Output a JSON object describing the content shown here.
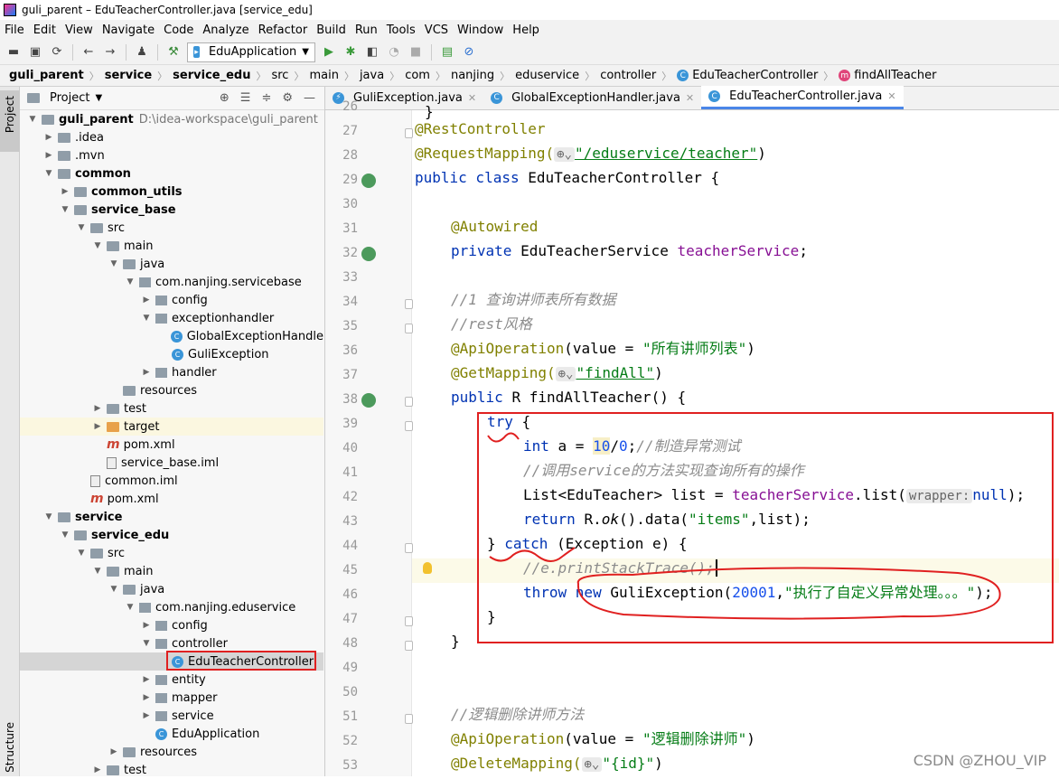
{
  "window": {
    "title": "guli_parent – EduTeacherController.java [service_edu]"
  },
  "menu": [
    "File",
    "Edit",
    "View",
    "Navigate",
    "Code",
    "Analyze",
    "Refactor",
    "Build",
    "Run",
    "Tools",
    "VCS",
    "Window",
    "Help"
  ],
  "toolbar": {
    "run_config": "EduApplication"
  },
  "breadcrumb": [
    "guli_parent",
    "service",
    "service_edu",
    "src",
    "main",
    "java",
    "com",
    "nanjing",
    "eduservice",
    "controller",
    "EduTeacherController",
    "findAllTeacher"
  ],
  "sidebar": {
    "project_tab": "Project",
    "bottom_tab": "Structure"
  },
  "project_panel": {
    "title": "Project",
    "root_path": "D:\\idea-workspace\\guli_parent"
  },
  "tree": [
    {
      "label": "guli_parent",
      "depth": 0,
      "icon": "folder",
      "arrow": "down",
      "bold": true
    },
    {
      "label": ".idea",
      "depth": 1,
      "icon": "folder",
      "arrow": "right"
    },
    {
      "label": ".mvn",
      "depth": 1,
      "icon": "folder",
      "arrow": "right"
    },
    {
      "label": "common",
      "depth": 1,
      "icon": "folder",
      "arrow": "down",
      "bold": true
    },
    {
      "label": "common_utils",
      "depth": 2,
      "icon": "folder",
      "arrow": "right",
      "bold": true
    },
    {
      "label": "service_base",
      "depth": 2,
      "icon": "folder",
      "arrow": "down",
      "bold": true
    },
    {
      "label": "src",
      "depth": 3,
      "icon": "folder",
      "arrow": "down"
    },
    {
      "label": "main",
      "depth": 4,
      "icon": "folder",
      "arrow": "down"
    },
    {
      "label": "java",
      "depth": 5,
      "icon": "folder",
      "arrow": "down"
    },
    {
      "label": "com.nanjing.servicebase",
      "depth": 6,
      "icon": "pkg",
      "arrow": "down"
    },
    {
      "label": "config",
      "depth": 7,
      "icon": "pkg",
      "arrow": "right"
    },
    {
      "label": "exceptionhandler",
      "depth": 7,
      "icon": "pkg",
      "arrow": "down"
    },
    {
      "label": "GlobalExceptionHandle",
      "depth": 8,
      "icon": "class",
      "arrow": ""
    },
    {
      "label": "GuliException",
      "depth": 8,
      "icon": "class",
      "arrow": ""
    },
    {
      "label": "handler",
      "depth": 7,
      "icon": "pkg",
      "arrow": "right"
    },
    {
      "label": "resources",
      "depth": 5,
      "icon": "folder",
      "arrow": ""
    },
    {
      "label": "test",
      "depth": 4,
      "icon": "folder",
      "arrow": "right"
    },
    {
      "label": "target",
      "depth": 4,
      "icon": "folder-orange",
      "arrow": "right"
    },
    {
      "label": "pom.xml",
      "depth": 4,
      "icon": "mvn",
      "arrow": ""
    },
    {
      "label": "service_base.iml",
      "depth": 4,
      "icon": "file",
      "arrow": ""
    },
    {
      "label": "common.iml",
      "depth": 3,
      "icon": "file",
      "arrow": ""
    },
    {
      "label": "pom.xml",
      "depth": 3,
      "icon": "mvn",
      "arrow": ""
    },
    {
      "label": "service",
      "depth": 1,
      "icon": "folder",
      "arrow": "down",
      "bold": true
    },
    {
      "label": "service_edu",
      "depth": 2,
      "icon": "folder",
      "arrow": "down",
      "bold": true
    },
    {
      "label": "src",
      "depth": 3,
      "icon": "folder",
      "arrow": "down"
    },
    {
      "label": "main",
      "depth": 4,
      "icon": "folder",
      "arrow": "down"
    },
    {
      "label": "java",
      "depth": 5,
      "icon": "folder",
      "arrow": "down"
    },
    {
      "label": "com.nanjing.eduservice",
      "depth": 6,
      "icon": "pkg",
      "arrow": "down"
    },
    {
      "label": "config",
      "depth": 7,
      "icon": "pkg",
      "arrow": "right"
    },
    {
      "label": "controller",
      "depth": 7,
      "icon": "pkg",
      "arrow": "down"
    },
    {
      "label": "EduTeacherController",
      "depth": 8,
      "icon": "class",
      "arrow": "",
      "selected": true
    },
    {
      "label": "entity",
      "depth": 7,
      "icon": "pkg",
      "arrow": "right"
    },
    {
      "label": "mapper",
      "depth": 7,
      "icon": "pkg",
      "arrow": "right"
    },
    {
      "label": "service",
      "depth": 7,
      "icon": "pkg",
      "arrow": "right"
    },
    {
      "label": "EduApplication",
      "depth": 7,
      "icon": "class",
      "arrow": ""
    },
    {
      "label": "resources",
      "depth": 5,
      "icon": "folder",
      "arrow": "right"
    },
    {
      "label": "test",
      "depth": 4,
      "icon": "folder",
      "arrow": "right"
    }
  ],
  "editor_tabs": [
    {
      "label": "GuliException.java",
      "active": false
    },
    {
      "label": "GlobalExceptionHandler.java",
      "active": false
    },
    {
      "label": "EduTeacherController.java",
      "active": true
    }
  ],
  "code": {
    "l27a": "@RestController",
    "l28a": "@RequestMapping(",
    "l28b": "\"/eduservice/teacher\"",
    "l28c": ")",
    "l29a": "public class ",
    "l29b": "EduTeacherController {",
    "l31a": "@Autowired",
    "l32a": "private ",
    "l32b": "EduTeacherService ",
    "l32c": "teacherService",
    "l32d": ";",
    "l34": "//1 查询讲师表所有数据",
    "l35": "//rest风格",
    "l36a": "@ApiOperation",
    "l36b": "(value = ",
    "l36c": "\"所有讲师列表\"",
    "l36d": ")",
    "l37a": "@GetMapping(",
    "l37b": "\"findAll\"",
    "l37c": ")",
    "l38a": "public ",
    "l38b": "R findAllTeacher() {",
    "l39a": "try",
    "l39b": " {",
    "l40a": "int ",
    "l40b": "a = ",
    "l40c": "10",
    "l40d": "/",
    "l40e": "0",
    "l40f": ";",
    "l40g": "//制造异常测试",
    "l41": "//调用service的方法实现查询所有的操作",
    "l42a": "List<EduTeacher> list = ",
    "l42b": "teacherService",
    "l42c": ".list(",
    "l42d": "wrapper:",
    "l42e": "null",
    "l42f": ");",
    "l43a": "return ",
    "l43b": "R.",
    "l43c": "ok",
    "l43d": "().data(",
    "l43e": "\"items\"",
    "l43f": ",list);",
    "l44a": "} ",
    "l44b": "catch",
    "l44c": " (Exception e) {",
    "l45": "//e.printStackTrace();",
    "l46a": "throw ",
    "l46b": "new ",
    "l46c": "GuliException(",
    "l46d": "20001",
    "l46e": ",",
    "l46f": "\"执行了自定义异常处理。。。\"",
    "l46g": ");",
    "l47": "}",
    "l48": "}",
    "l51": "//逻辑删除讲师方法",
    "l52a": "@ApiOperation",
    "l52b": "(value = ",
    "l52c": "\"逻辑删除讲师\"",
    "l52d": ")",
    "l53a": "@DeleteMapping(",
    "l53b": "\"{id}\"",
    "l53c": ")",
    "l26": "}"
  },
  "line_numbers": [
    "26",
    "27",
    "28",
    "29",
    "30",
    "31",
    "32",
    "33",
    "34",
    "35",
    "36",
    "37",
    "38",
    "39",
    "40",
    "41",
    "42",
    "43",
    "44",
    "45",
    "46",
    "47",
    "48",
    "49",
    "50",
    "51",
    "52",
    "53"
  ],
  "watermark": "CSDN @ZHOU_VIP",
  "colors": {
    "annotation": "#808000",
    "keyword": "#0033b3",
    "string": "#067d17",
    "comment": "#8c8c8c",
    "field": "#871094",
    "number": "#1750eb",
    "highlight_box": "#e02020"
  }
}
